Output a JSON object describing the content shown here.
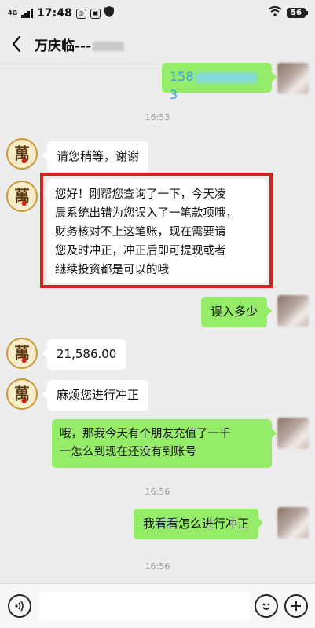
{
  "status_bar": {
    "network": "4G",
    "time": "17:48",
    "battery": "56"
  },
  "nav": {
    "title": "万庆临---"
  },
  "messages": {
    "m1_phone_prefix": "158",
    "m1_phone_suffix": "3",
    "t1": "16:53",
    "m2": "请您稍等，谢谢",
    "m3_line1": "您好！刚帮您查询了一下，今天凌",
    "m3_line2": "晨系统出错为您误入了一笔款项哦，",
    "m3_line3": "财务核对不上这笔账，现在需要请",
    "m3_line4": "您及时冲正，冲正后即可提现或者",
    "m3_line5": "继续投资都是可以的哦",
    "m4": "误入多少",
    "m5": "21,586.00",
    "m6": "麻烦您进行冲正",
    "m7_line1": "哦，那我今天有个朋友充值了一千",
    "m7_line2": "一怎么到现在还没有到账号",
    "t2": "16:56",
    "m8": "我看看怎么进行冲正",
    "t3": "16:56"
  },
  "colors": {
    "out_bubble": "#95ec69",
    "in_bubble": "#ffffff",
    "highlight": "#d4241f",
    "background": "#ededed"
  }
}
